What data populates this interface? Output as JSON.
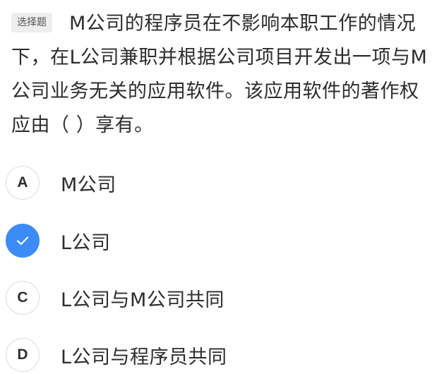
{
  "question": {
    "type_label": "选择题",
    "text": "M公司的程序员在不影响本职工作的情况下，在L公司兼职并根据公司项目开发出一项与M公司业务无关的应用软件。该应用软件的著作权应由（ ）享有。"
  },
  "options": [
    {
      "letter": "A",
      "text": "M公司",
      "selected": false
    },
    {
      "letter": "",
      "text": "L公司",
      "selected": true,
      "icon": "check-icon"
    },
    {
      "letter": "C",
      "text": "L公司与M公司共同",
      "selected": false
    },
    {
      "letter": "D",
      "text": "L公司与程序员共同",
      "selected": false
    }
  ],
  "colors": {
    "accent": "#3d8cf5",
    "text": "#2d2d2d",
    "tag_bg": "#eeeeee"
  }
}
